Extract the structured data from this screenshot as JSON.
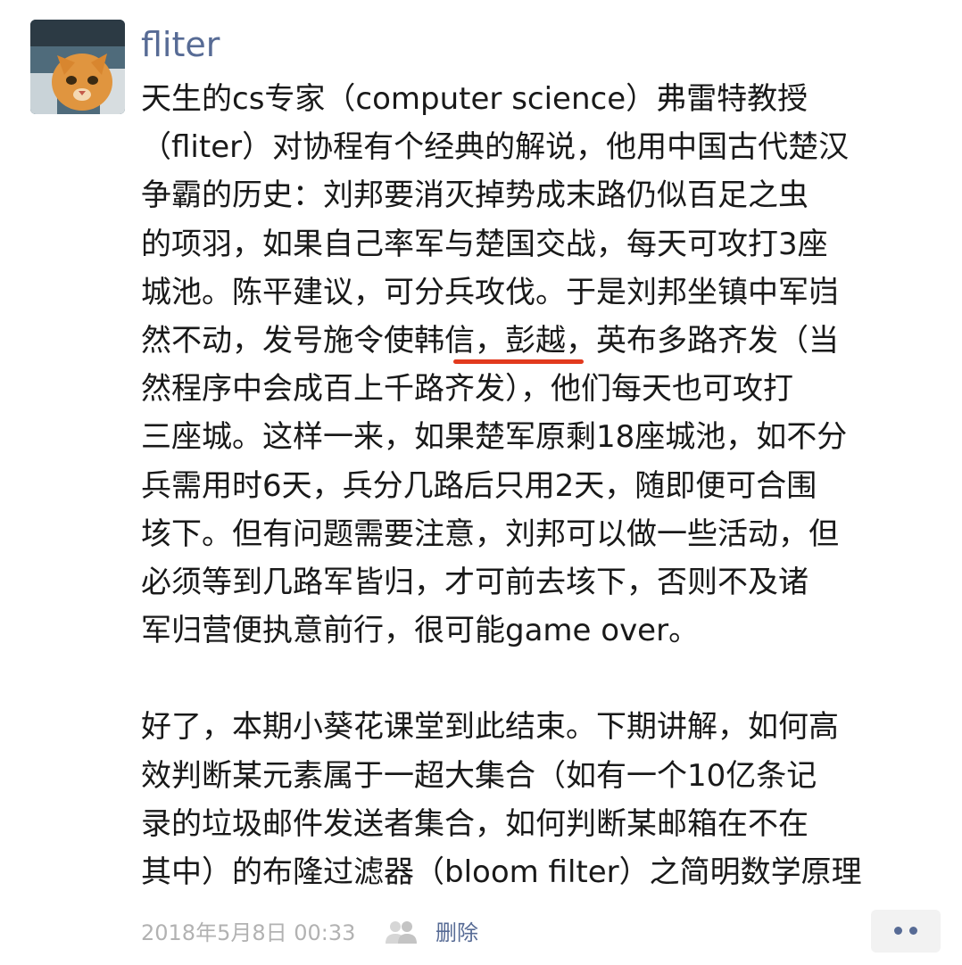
{
  "user": {
    "name": "fliter"
  },
  "post": {
    "lines_para1": [
      "天生的cs专家（computer science）弗雷特教授",
      "（fliter）对协程有个经典的解说，他用中国古代楚汉",
      "争霸的历史：刘邦要消灭掉势成末路仍似百足之虫",
      "的项羽，如果自己率军与楚国交战，每天可攻打3座",
      "城池。陈平建议，可分兵攻伐。于是刘邦坐镇中军岿",
      "然不动，发号施令使韩信，彭越，英布多路齐发（当",
      "然程序中会成百上千路齐发），他们每天也可攻打",
      "三座城。这样一来，如果楚军原剩18座城池，如不分",
      "兵需用时6天，兵分几路后只用2天，随即便可合围",
      "垓下。但有问题需要注意，刘邦可以做一些活动，但",
      "必须等到几路军皆归，才可前去垓下，否则不及诸",
      "军归营便执意前行，很可能game over。"
    ],
    "lines_para2": [
      "好了，本期小葵花课堂到此结束。下期讲解，如何高",
      "效判断某元素属于一超大集合（如有一个10亿条记",
      "录的垃圾邮件发送者集合，如何判断某邮箱在不在",
      "其中）的布隆过滤器（bloom filter）之简明数学原理"
    ]
  },
  "footer": {
    "timestamp": "2018年5月8日 00:33",
    "privacy_icon": "people-icon",
    "delete_label": "删除",
    "more_icon": "two-dots-icon"
  },
  "colors": {
    "link": "#576b95",
    "text": "#191919",
    "meta": "#b2b2b2",
    "annotation": "#e23a1e"
  }
}
